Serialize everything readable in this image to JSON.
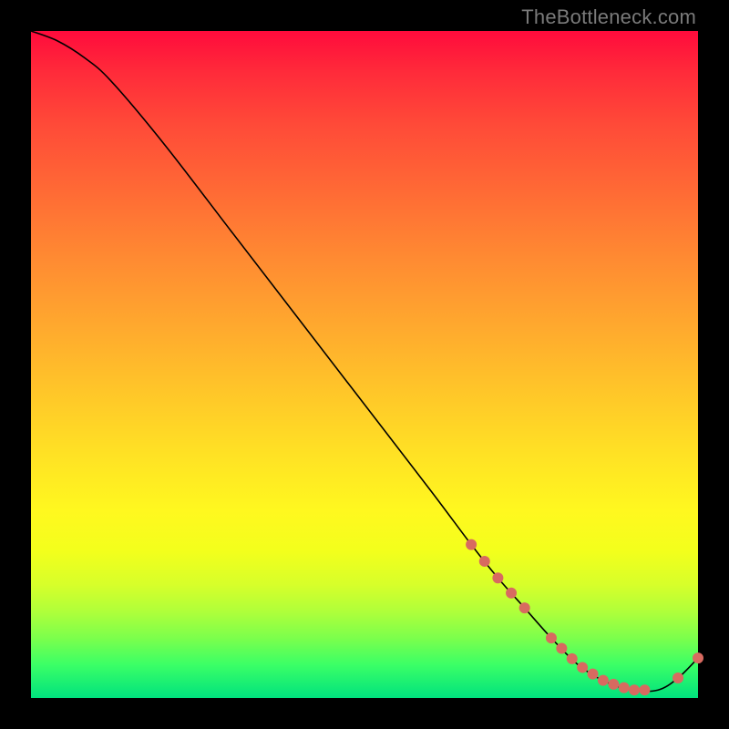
{
  "watermark": "TheBottleneck.com",
  "chart_data": {
    "type": "line",
    "title": "",
    "xlabel": "",
    "ylabel": "",
    "xlim": [
      0,
      100
    ],
    "ylim": [
      0,
      100
    ],
    "series": [
      {
        "name": "curve",
        "x": [
          0,
          4,
          8,
          12,
          20,
          30,
          40,
          50,
          60,
          66,
          70,
          74,
          78,
          82,
          86,
          90,
          94,
          97,
          100
        ],
        "values": [
          100,
          98.5,
          96,
          92.5,
          83,
          70,
          57,
          44,
          31,
          23,
          18,
          13.5,
          9,
          5,
          2.5,
          1.2,
          1.2,
          3,
          6
        ]
      }
    ],
    "markers": [
      {
        "x_range": [
          66,
          74
        ],
        "count": 5,
        "note": "clustered dots on descent"
      },
      {
        "x_range": [
          78,
          92
        ],
        "count": 10,
        "note": "clustered dots at trough"
      },
      {
        "x_range": [
          97,
          100
        ],
        "count": 2,
        "note": "dots on tail rise"
      }
    ]
  },
  "colors": {
    "watermark": "#7a7a7a",
    "curve": "#000000",
    "dots": "#d86a60"
  }
}
